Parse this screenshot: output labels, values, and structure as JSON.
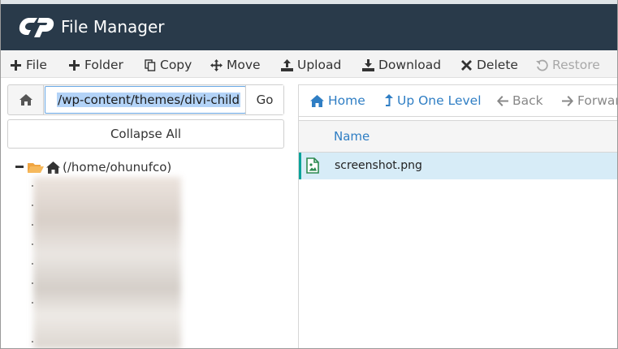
{
  "app": {
    "title": "File Manager",
    "logo": "cP",
    "colors": {
      "header_bg": "#293a4a",
      "accent": "#2f7ec4",
      "selected_row": "#d7ecf7",
      "row_marker": "#0aa39a"
    }
  },
  "toolbar": {
    "file": "File",
    "folder": "Folder",
    "copy": "Copy",
    "move": "Move",
    "upload": "Upload",
    "download": "Download",
    "delete": "Delete",
    "restore": "Restore"
  },
  "path": {
    "value": "/wp-content/themes/divi-child",
    "go": "Go"
  },
  "sidebar": {
    "collapse_all": "Collapse All",
    "tree_root": "(/home/ohunufco)"
  },
  "nav": {
    "home": "Home",
    "up_one_level": "Up One Level",
    "back": "Back",
    "forward": "Forward"
  },
  "table": {
    "columns": [
      "Name"
    ],
    "rows": [
      {
        "name": "screenshot.png",
        "icon": "image-file-icon",
        "selected": true
      }
    ]
  }
}
